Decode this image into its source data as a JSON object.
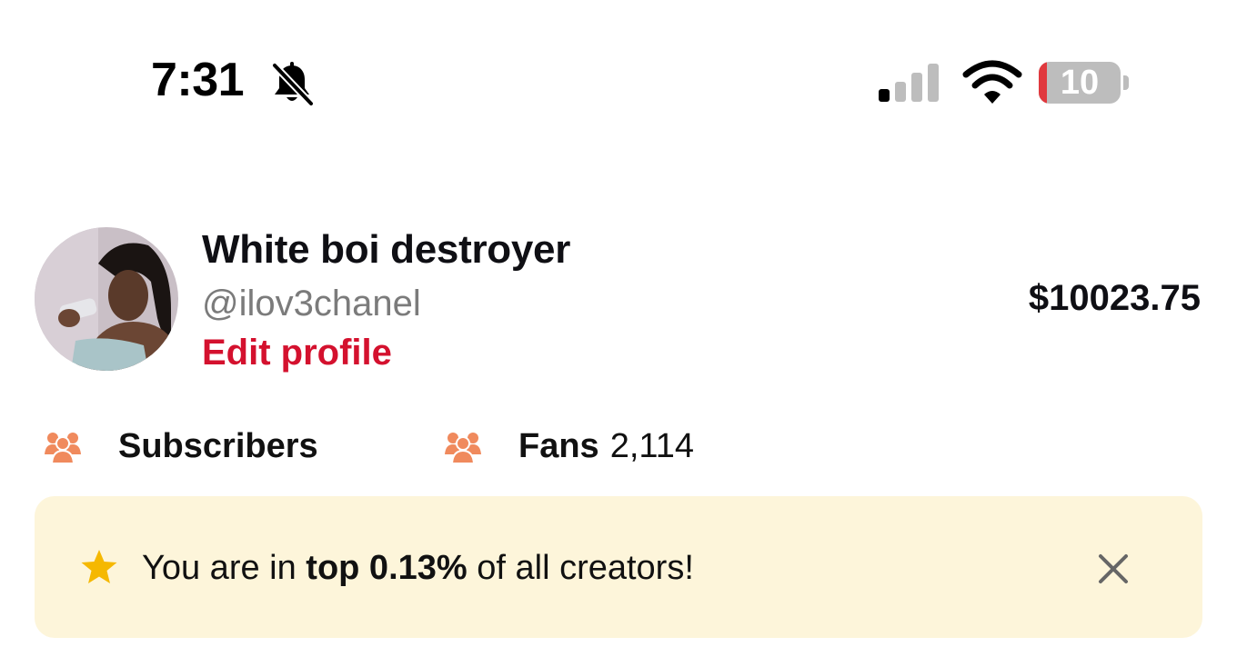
{
  "status_bar": {
    "time": "7:31",
    "bell_icon": "bell-slash-icon",
    "signal_icon": "cellular-signal-icon",
    "signal_bars_active": 1,
    "signal_bars_total": 4,
    "wifi_icon": "wifi-icon",
    "battery_percent": "10",
    "battery_level": 0.1,
    "battery_color": "#e0393e"
  },
  "profile": {
    "display_name": "White boi destroyer",
    "username": "@ilov3chanel",
    "edit_label": "Edit profile",
    "balance": "$10023.75"
  },
  "stats": {
    "subscribers": {
      "icon": "people-group-icon",
      "label": "Subscribers",
      "value": ""
    },
    "fans": {
      "icon": "people-group-icon",
      "label": "Fans",
      "value": "2,114"
    }
  },
  "banner": {
    "icon": "star-icon",
    "prefix": "You are in ",
    "highlight": "top 0.13%",
    "suffix": " of all creators!",
    "close_icon": "close-icon",
    "background": "#fdf5da"
  },
  "colors": {
    "accent_red": "#d4112e",
    "stat_icon": "#f08a5d",
    "star": "#f5b800"
  }
}
